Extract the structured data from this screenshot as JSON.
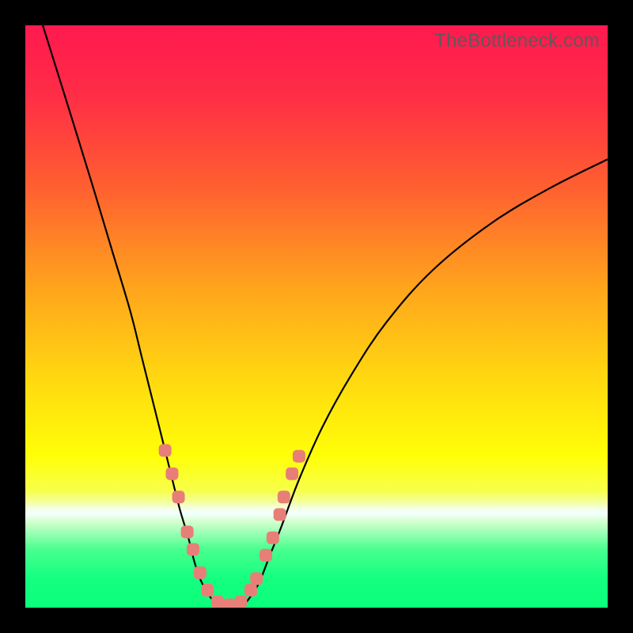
{
  "watermark": "TheBottleneck.com",
  "colors": {
    "frame": "#000000",
    "curve": "#000000",
    "marker": "#e77f78",
    "gradient_stops": [
      {
        "pct": 0,
        "color": "#ff1950"
      },
      {
        "pct": 12,
        "color": "#ff2d46"
      },
      {
        "pct": 28,
        "color": "#ff6030"
      },
      {
        "pct": 45,
        "color": "#ffa41c"
      },
      {
        "pct": 60,
        "color": "#ffd611"
      },
      {
        "pct": 74,
        "color": "#ffff07"
      },
      {
        "pct": 80,
        "color": "#f7ff4c"
      },
      {
        "pct": 82,
        "color": "#f2ffa6"
      },
      {
        "pct": 83,
        "color": "#f5ffe8"
      },
      {
        "pct": 84,
        "color": "#efffff"
      },
      {
        "pct": 85,
        "color": "#d9ffd1"
      },
      {
        "pct": 90,
        "color": "#49ff8e"
      },
      {
        "pct": 95,
        "color": "#14ff80"
      },
      {
        "pct": 100,
        "color": "#0aff7a"
      }
    ]
  },
  "chart_data": {
    "type": "line",
    "title": "",
    "xlabel": "",
    "ylabel": "",
    "xlim": [
      0,
      100
    ],
    "ylim": [
      0,
      100
    ],
    "grid": false,
    "series": [
      {
        "name": "left-curve",
        "x": [
          3,
          8,
          12,
          15,
          18,
          20,
          22,
          23.5,
          25,
          26.5,
          28,
          29,
          30,
          31,
          32
        ],
        "y": [
          100,
          84,
          71,
          61,
          51,
          43,
          35,
          29,
          23,
          17,
          12,
          8,
          5,
          3,
          1.5
        ]
      },
      {
        "name": "valley-floor",
        "x": [
          32,
          34,
          36,
          38
        ],
        "y": [
          1.5,
          0.5,
          0.5,
          1.0
        ]
      },
      {
        "name": "right-curve",
        "x": [
          38,
          40,
          42,
          44,
          47,
          51,
          56,
          62,
          70,
          80,
          90,
          100
        ],
        "y": [
          1.0,
          4,
          9,
          14,
          22,
          31,
          40,
          49,
          58,
          66,
          72,
          77
        ]
      }
    ],
    "markers": {
      "name": "highlight-points",
      "shape": "rounded-square",
      "points": [
        {
          "x": 24.0,
          "y": 27
        },
        {
          "x": 25.2,
          "y": 23
        },
        {
          "x": 26.3,
          "y": 19
        },
        {
          "x": 27.8,
          "y": 13
        },
        {
          "x": 28.8,
          "y": 10
        },
        {
          "x": 30.0,
          "y": 6
        },
        {
          "x": 31.3,
          "y": 3
        },
        {
          "x": 33.0,
          "y": 1
        },
        {
          "x": 35.0,
          "y": 0.5
        },
        {
          "x": 37.0,
          "y": 1
        },
        {
          "x": 38.7,
          "y": 3
        },
        {
          "x": 39.7,
          "y": 5
        },
        {
          "x": 41.3,
          "y": 9
        },
        {
          "x": 42.5,
          "y": 12
        },
        {
          "x": 43.7,
          "y": 16
        },
        {
          "x": 44.4,
          "y": 19
        },
        {
          "x": 45.8,
          "y": 23
        },
        {
          "x": 47.0,
          "y": 26
        }
      ]
    }
  }
}
